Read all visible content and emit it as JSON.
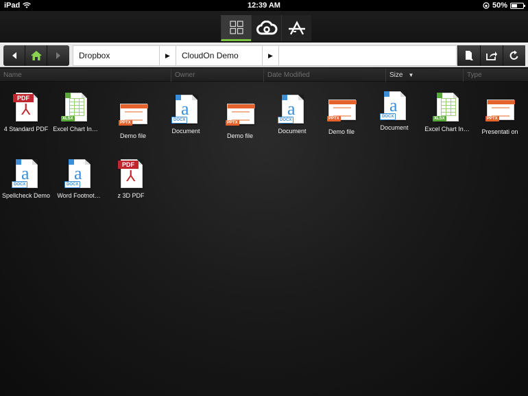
{
  "status_bar": {
    "device": "iPad",
    "time": "12:39 AM",
    "battery": "50%"
  },
  "view_switcher": {
    "items": [
      {
        "name": "grid-view",
        "icon": "grid-icon",
        "active": true
      },
      {
        "name": "cloud-view",
        "icon": "cloud-icon",
        "active": false
      },
      {
        "name": "apps-view",
        "icon": "app-store-icon",
        "active": false
      }
    ],
    "accent_color": "#7cc242"
  },
  "breadcrumbs": [
    {
      "label": "Dropbox"
    },
    {
      "label": "CloudOn Demo"
    }
  ],
  "columns": [
    {
      "label": "Name"
    },
    {
      "label": "Owner"
    },
    {
      "label": "Date Modified"
    },
    {
      "label": "Size",
      "sort": "▼"
    },
    {
      "label": "Type"
    }
  ],
  "files": [
    {
      "label": "4 Standard PDF",
      "type": "pdf",
      "tag": "PDF"
    },
    {
      "label": "Excel Chart In…",
      "type": "xlsx",
      "tag": "XLSX"
    },
    {
      "label": "Demo file",
      "type": "pptx",
      "tag": "PPTX"
    },
    {
      "label": "Document",
      "type": "docx",
      "tag": "DOCX"
    },
    {
      "label": "Demo file",
      "type": "pptx",
      "tag": "PPTX"
    },
    {
      "label": "Document",
      "type": "docx",
      "tag": "DOCX"
    },
    {
      "label": "Demo file",
      "type": "pptx",
      "tag": "PPTX"
    },
    {
      "label": "Document",
      "type": "docx",
      "tag": "DOCX"
    },
    {
      "label": "Excel Chart In…",
      "type": "xlsx",
      "tag": "XLSX"
    },
    {
      "label": "Presentati on",
      "type": "pptx",
      "tag": "PPTX"
    },
    {
      "label": "Spellcheck Demo",
      "type": "docx",
      "tag": "DOCX"
    },
    {
      "label": "Word Footnot…",
      "type": "docx",
      "tag": "DOCX"
    },
    {
      "label": "z 3D PDF",
      "type": "pdf",
      "tag": "PDF"
    }
  ],
  "colors": {
    "pdf": "#c0262d",
    "docx": "#3a8fd8",
    "pptx": "#e4622b",
    "xlsx": "#5aa83a"
  }
}
